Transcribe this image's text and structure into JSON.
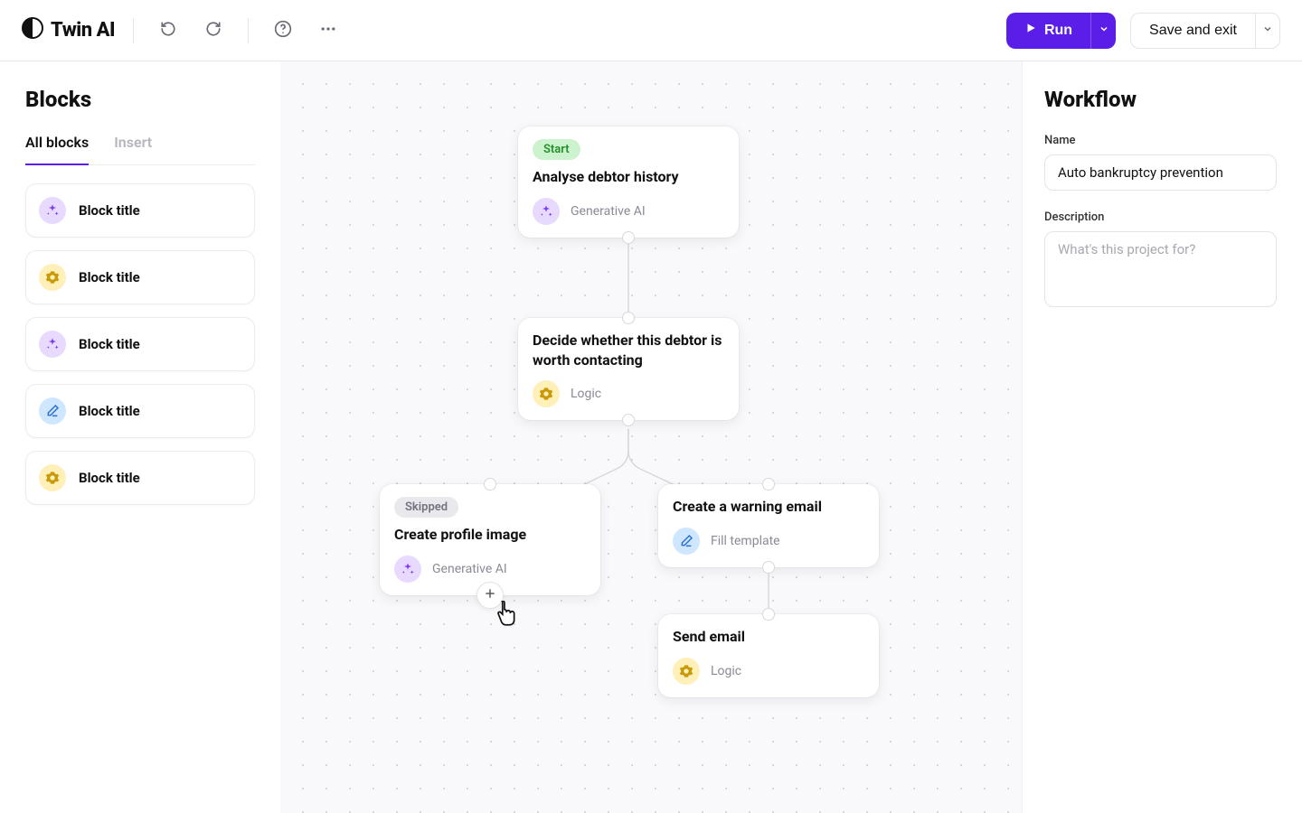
{
  "app": {
    "name": "Twin AI"
  },
  "header": {
    "run_label": "Run",
    "save_label": "Save and exit"
  },
  "left": {
    "title": "Blocks",
    "tabs": {
      "all": "All blocks",
      "insert": "Insert"
    },
    "items": [
      {
        "type": "ai",
        "label": "Block title"
      },
      {
        "type": "logic",
        "label": "Block title"
      },
      {
        "type": "ai",
        "label": "Block title"
      },
      {
        "type": "tmpl",
        "label": "Block title"
      },
      {
        "type": "logic",
        "label": "Block title"
      }
    ]
  },
  "right": {
    "title": "Workflow",
    "name_label": "Name",
    "name_value": "Auto bankruptcy prevention",
    "desc_label": "Description",
    "desc_placeholder": "What's this project for?"
  },
  "badges": {
    "start": "Start",
    "skipped": "Skipped"
  },
  "types": {
    "ai": "Generative AI",
    "logic": "Logic",
    "tmpl": "Fill template"
  },
  "nodes": {
    "n1": {
      "title": "Analyse debtor history"
    },
    "n2": {
      "title": "Decide whether this debtor is worth contacting"
    },
    "n3": {
      "title": "Create profile image"
    },
    "n4": {
      "title": "Create a warning email"
    },
    "n5": {
      "title": "Send email"
    }
  }
}
